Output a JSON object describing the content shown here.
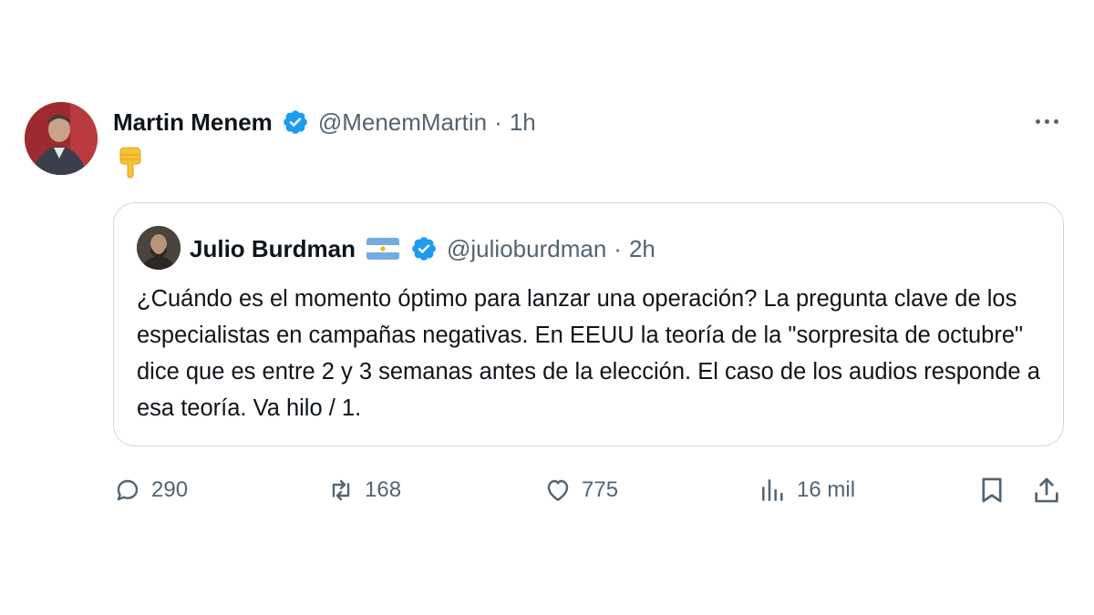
{
  "tweet": {
    "author_name": "Martin Menem",
    "author_handle": "@MenemMartin",
    "separator": "·",
    "time": "1h",
    "body_emoji_icon": "backhand-index-pointing-down-emoji",
    "more_icon": "more-horizontal-icon"
  },
  "quote": {
    "author_name": "Julio Burdman",
    "author_handle": "@julioburdman",
    "separator": "·",
    "time": "2h",
    "flag_icon": "argentina-flag-emoji",
    "text": "¿Cuándo es el momento óptimo para lanzar una operación? La pregunta clave de los especialistas en campañas negativas. En EEUU la teoría de la \"sorpresita de octubre\" dice que es entre 2 y 3 semanas antes de la elección. El caso de los audios responde a esa teoría. Va hilo / 1."
  },
  "actions": {
    "replies": "290",
    "reposts": "168",
    "likes": "775",
    "views": "16 mil"
  },
  "colors": {
    "verified_blue": "#1d9bf0",
    "secondary_text": "#536471",
    "border": "#cfd9de",
    "primary_text": "#0f1419"
  }
}
